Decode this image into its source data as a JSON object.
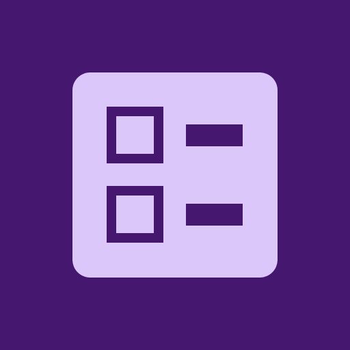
{
  "icon": {
    "name": "checklist-icon",
    "background_color": "#45176f",
    "card_color": "#dcc7fb",
    "mark_color": "#45176f",
    "items": [
      {
        "name": "checklist-item-1",
        "checked": false
      },
      {
        "name": "checklist-item-2",
        "checked": false
      }
    ]
  }
}
